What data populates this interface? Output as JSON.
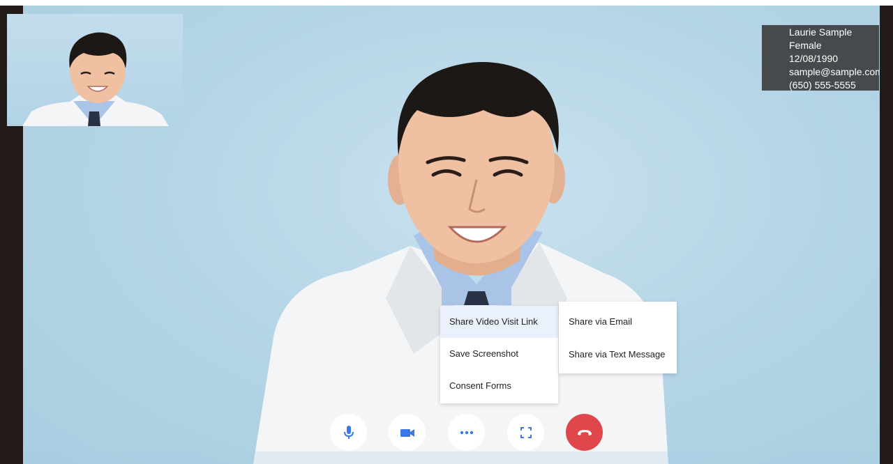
{
  "patient": {
    "name": "Laurie Sample",
    "gender": "Female",
    "dob": "12/08/1990",
    "email": "sample@sample.com",
    "phone": "(650) 555-5555"
  },
  "menu": {
    "items": [
      {
        "label": "Share Video Visit Link",
        "active": true
      },
      {
        "label": "Save Screenshot"
      },
      {
        "label": "Consent Forms"
      }
    ],
    "submenu": [
      {
        "label": "Share via Email"
      },
      {
        "label": "Share via Text Message"
      }
    ]
  },
  "controls": {
    "icons": [
      "microphone-icon",
      "video-camera-icon",
      "more-options-icon",
      "fullscreen-icon",
      "end-call-icon"
    ]
  },
  "colors": {
    "accent": "#3b78e7",
    "end_call": "#e0474c",
    "background": "#b6d6e7"
  }
}
